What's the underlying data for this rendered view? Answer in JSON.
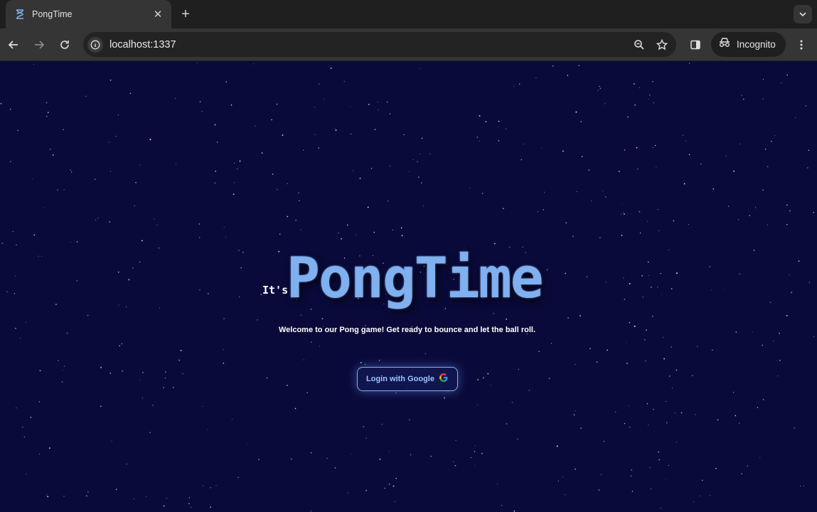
{
  "browser": {
    "tab": {
      "title": "PongTime",
      "icon": "hourglass-icon",
      "close_symbol": "✕"
    },
    "new_tab_symbol": "+",
    "url": "localhost:1337",
    "incognito_label": "Incognito"
  },
  "page": {
    "prefix": "It's",
    "title": "PongTime",
    "welcome": "Welcome to our Pong game! Get ready to bounce and let the ball roll.",
    "login_button": "Login with Google",
    "colors": {
      "background": "#0a0a3a",
      "accent": "#7fb0f0",
      "text": "#ffffff"
    }
  }
}
